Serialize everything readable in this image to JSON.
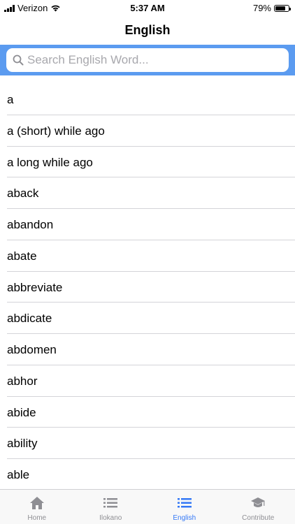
{
  "status_bar": {
    "carrier": "Verizon",
    "time": "5:37 AM",
    "battery_percent": "79%",
    "battery_level": 0.79
  },
  "nav": {
    "title": "English"
  },
  "search": {
    "placeholder": "Search English Word...",
    "value": ""
  },
  "words": [
    "a",
    "a (short) while ago",
    "a long while ago",
    "aback",
    "abandon",
    "abate",
    "abbreviate",
    "abdicate",
    "abdomen",
    "abhor",
    "abide",
    "ability",
    "able"
  ],
  "tabs": [
    {
      "label": "Home",
      "icon": "home-icon",
      "active": false
    },
    {
      "label": "Ilokano",
      "icon": "list-icon",
      "active": false
    },
    {
      "label": "English",
      "icon": "list-icon",
      "active": true
    },
    {
      "label": "Contribute",
      "icon": "graduation-cap-icon",
      "active": false
    }
  ],
  "colors": {
    "accent": "#3478f6",
    "search_bar_bg": "#5b9bf0",
    "tab_inactive": "#8e8e93"
  }
}
